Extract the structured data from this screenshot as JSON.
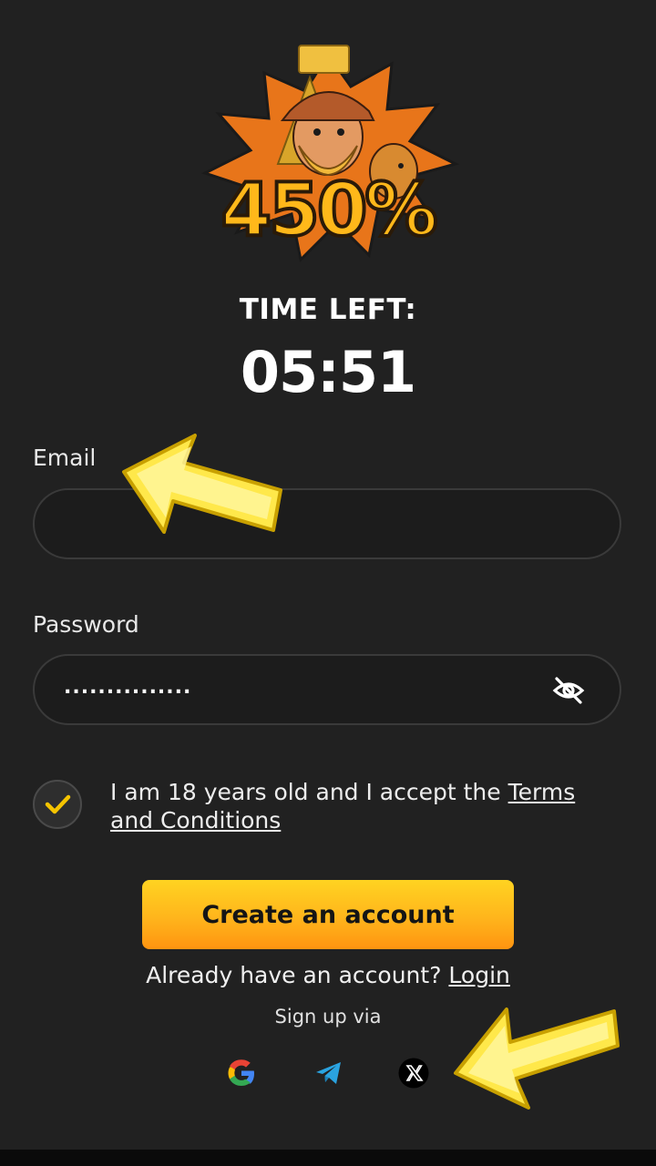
{
  "promo": {
    "bonus_text": "450%",
    "time_left_label": "TIME LEFT:",
    "timer": "05:51"
  },
  "form": {
    "email_label": "Email",
    "email_value": "",
    "password_label": "Password",
    "password_masked": "...............",
    "consent_text": "I am 18 years old and I accept the ",
    "terms_link": "Terms and Conditions",
    "consent_checked": true,
    "create_button": "Create an account"
  },
  "login": {
    "prompt": "Already have an account? ",
    "link": "Login"
  },
  "social": {
    "label": "Sign up via",
    "providers": [
      "google-icon",
      "telegram-icon",
      "x-icon"
    ]
  },
  "colors": {
    "background": "#212121",
    "accent": "#ffc21c",
    "checkmark": "#f5c400"
  }
}
